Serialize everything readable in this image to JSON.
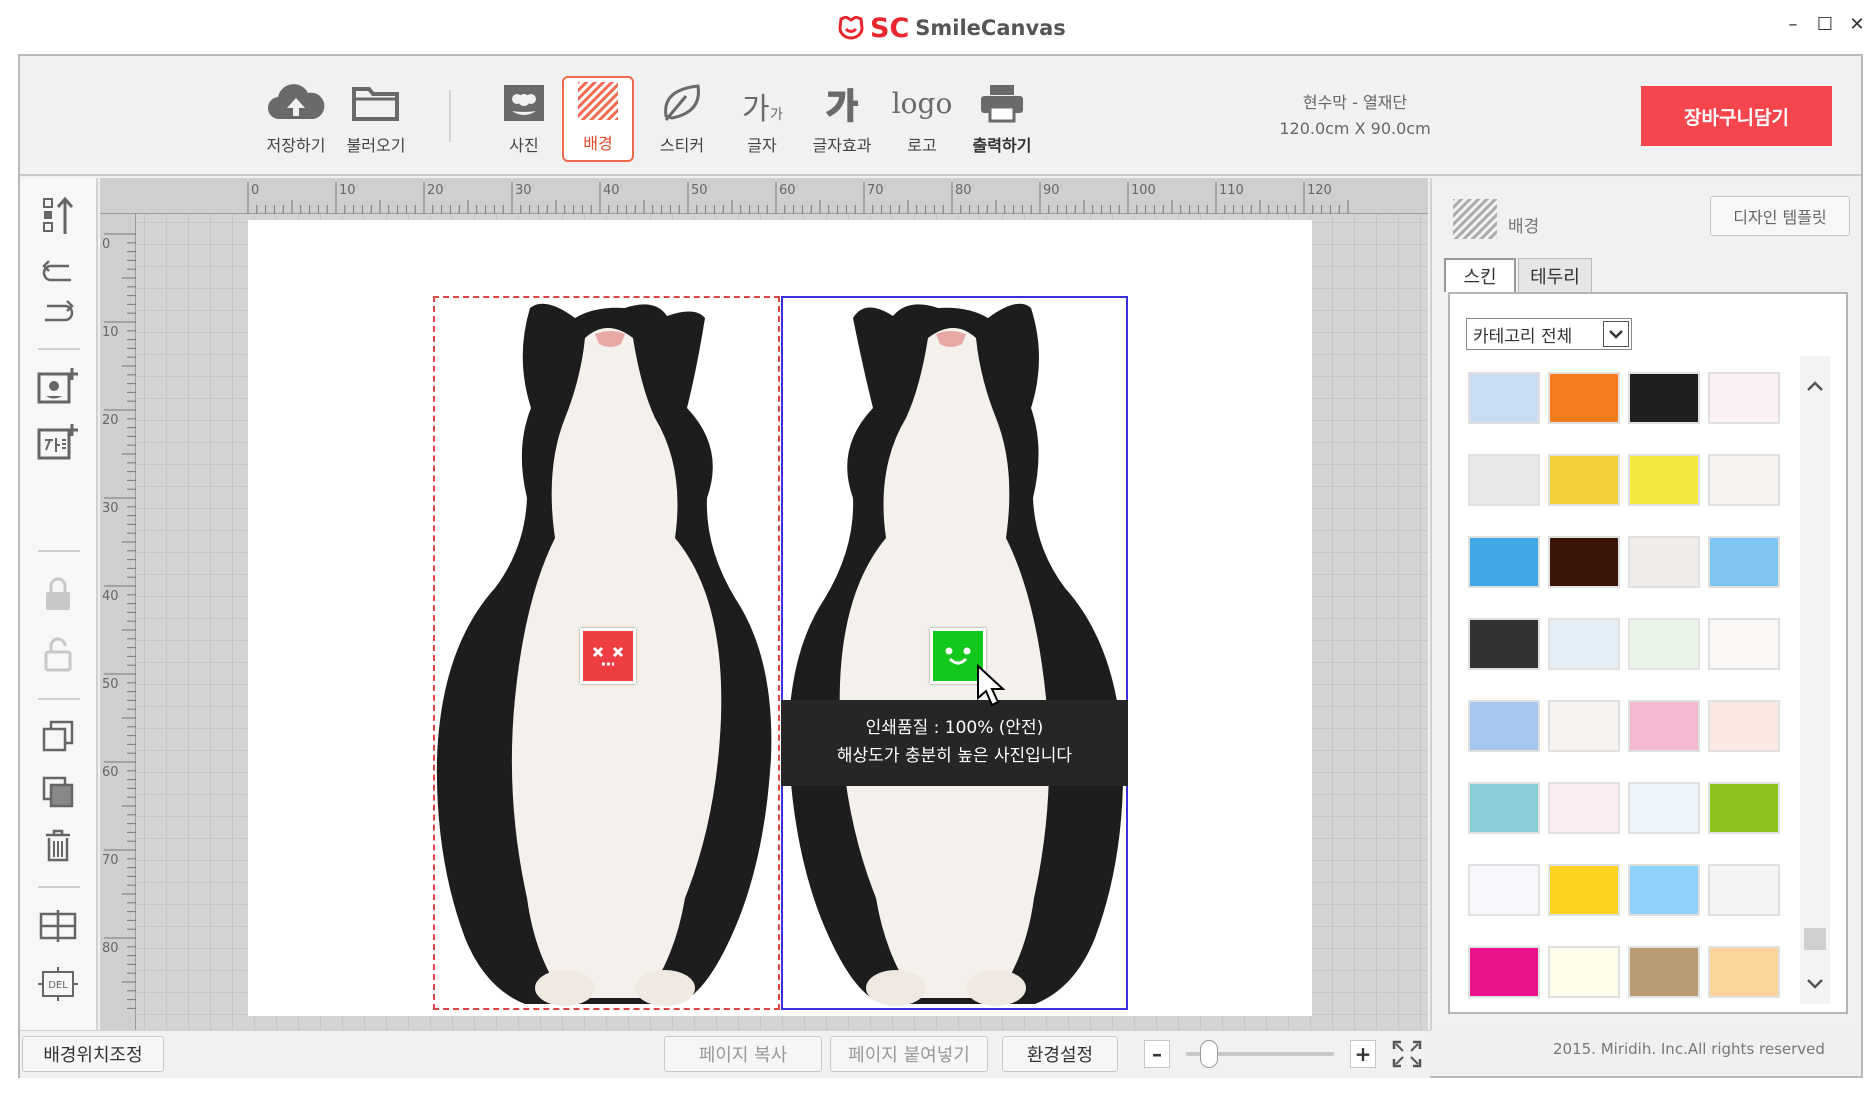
{
  "app": {
    "logo_mark": "SC",
    "name": "SmileCanvas"
  },
  "window": {
    "minimize": "–",
    "maximize": "☐",
    "close": "✕"
  },
  "toolbar": {
    "save": "저장하기",
    "load": "불러오기",
    "photo": "사진",
    "background": "배경",
    "sticker": "스티커",
    "text": "글자",
    "text_effect": "글자효과",
    "logo": "로고",
    "print": "출력하기",
    "logo_icon_text": "logo",
    "text_icon_main": "가",
    "text_icon_sub": "가"
  },
  "product": {
    "name": "현수막 - 열재단",
    "size": "120.0cm  X  90.0cm"
  },
  "cart_button": "장바구니담기",
  "ruler": {
    "h": [
      "0",
      "10",
      "20",
      "30",
      "40",
      "50",
      "60",
      "70",
      "80",
      "90",
      "100",
      "110",
      "120"
    ],
    "v": [
      "0",
      "10",
      "20",
      "30",
      "40",
      "50",
      "60",
      "70",
      "80"
    ]
  },
  "canvas": {
    "tooltip_line1": "인쇄품질 : 100% (안전)",
    "tooltip_line2": "해상도가 충분히 높은 사진입니다",
    "quality_left": "bad",
    "quality_right": "good"
  },
  "right_panel": {
    "title": "배경",
    "template_button": "디자인 템플릿",
    "tabs": [
      "스킨",
      "테두리"
    ],
    "active_tab": "스킨",
    "category_select": "카테고리 전체",
    "swatches": [
      [
        "#c8dcf3",
        "#f57b1c",
        "#1f1f1f",
        "#fbf0f2"
      ],
      [
        "#e8e6e6",
        "#f3d13a",
        "#f4e83c",
        "#f8f3ee"
      ],
      [
        "#3fa7e6",
        "#3b1408",
        "#f0ebe6",
        "#7ec6ef"
      ],
      [
        "#323232",
        "#e3eef6",
        "#eaf4e6",
        "#fbf7f4"
      ],
      [
        "#a7c6ee",
        "#f8f2ee",
        "#f3b8d2",
        "#fae7e1"
      ],
      [
        "#8bd0d8",
        "#fbecef",
        "#eef6fb",
        "#8cc21b"
      ],
      [
        "#f6f8fc",
        "#ffd21f",
        "#8fd1fb",
        "#f6f4f2"
      ],
      [
        "#e8138b",
        "#fdfde9",
        "#b89a73",
        "#fbd499"
      ]
    ],
    "copyright": "2015. Miridih. Inc.All rights reserved"
  },
  "bottom_bar": {
    "bg_position": "배경위치조정",
    "page_copy": "페이지 복사",
    "page_paste": "페이지 붙여넣기",
    "settings": "환경설정",
    "zoom_out": "–",
    "zoom_in": "+"
  }
}
